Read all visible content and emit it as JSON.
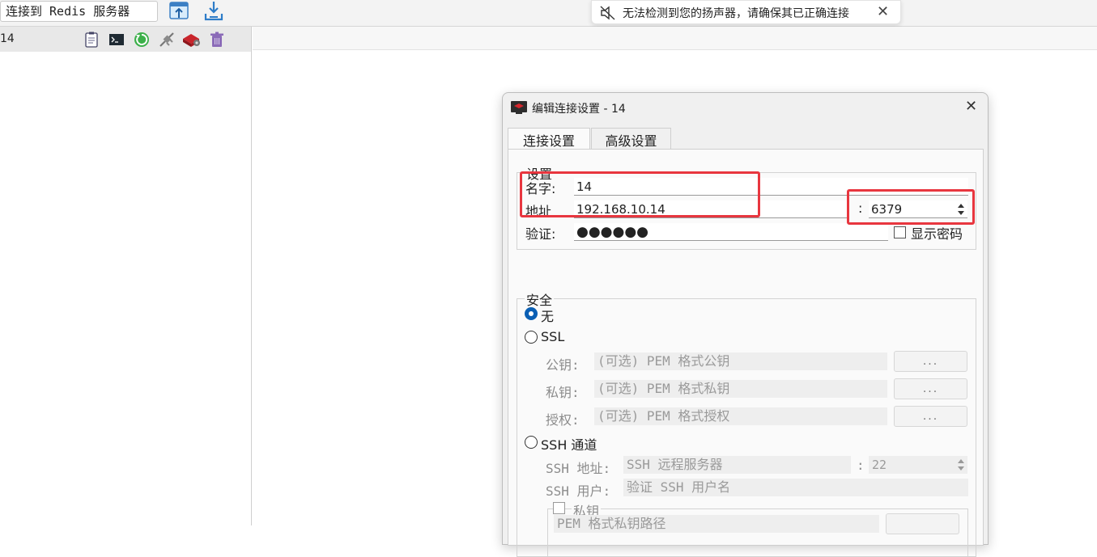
{
  "toolbar": {
    "connect_label": "连接到 Redis 服务器",
    "icons": [
      "import-icon",
      "export-icon"
    ]
  },
  "toast": {
    "message": "无法检测到您的扬声器，请确保其已正确连接",
    "close": "✕"
  },
  "sidebar": {
    "connection_name": "14",
    "row_icons": [
      "clipboard-icon",
      "console-icon",
      "reload-icon",
      "disconnect-icon",
      "settings-icon",
      "delete-icon"
    ]
  },
  "dialog": {
    "title": "编辑连接设置 - 14",
    "close": "✕",
    "tabs": [
      {
        "label": "连接设置",
        "active": true
      },
      {
        "label": "高级设置",
        "active": false
      }
    ],
    "settings": {
      "group_title": "设置",
      "name_label": "名字:",
      "name_value": "14",
      "address_label": "地址",
      "address_value": "192.168.10.14",
      "port_separator": ":",
      "port_value": "6379",
      "auth_label": "验证:",
      "auth_value": "●●●●●●",
      "show_password_label": "显示密码",
      "show_password_checked": false
    },
    "security": {
      "group_title": "安全",
      "selected": "无",
      "none_label": "无",
      "ssl_label": "SSL",
      "public_key_label": "公钥:",
      "public_key_placeholder": "(可选) PEM 格式公钥",
      "private_key_label": "私钥:",
      "private_key_placeholder": "(可选) PEM 格式私钥",
      "authority_label": "授权:",
      "authority_placeholder": "(可选) PEM 格式授权",
      "browse_label": "...",
      "ssh_label": "SSH 通道",
      "ssh_address_label": "SSH 地址:",
      "ssh_address_placeholder": "SSH 远程服务器",
      "ssh_port_separator": ":",
      "ssh_port_value": "22",
      "ssh_user_label": "SSH 用户:",
      "ssh_user_placeholder": "验证 SSH 用户名",
      "private_key_check_label": "私钥",
      "private_key_path_placeholder": "PEM 格式私钥路径"
    }
  },
  "colors": {
    "highlight_box": "#e8363f",
    "radio_selected": "#0a5fb4"
  }
}
